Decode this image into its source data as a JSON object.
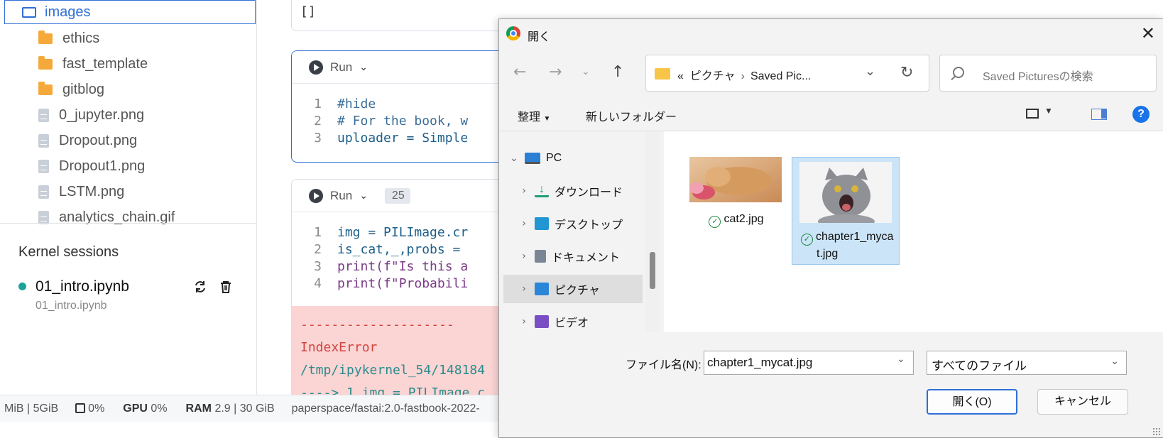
{
  "sidebar": {
    "selected_folder": "images",
    "items": [
      {
        "name": "ethics",
        "kind": "folder"
      },
      {
        "name": "fast_template",
        "kind": "folder"
      },
      {
        "name": "gitblog",
        "kind": "folder"
      },
      {
        "name": "0_jupyter.png",
        "kind": "file"
      },
      {
        "name": "Dropout.png",
        "kind": "file"
      },
      {
        "name": "Dropout1.png",
        "kind": "file"
      },
      {
        "name": "LSTM.png",
        "kind": "file"
      },
      {
        "name": "analytics_chain.gif",
        "kind": "file"
      }
    ],
    "kernel_heading": "Kernel sessions",
    "kernel": {
      "name": "01_intro.ipynb",
      "path": "01_intro.ipynb"
    }
  },
  "notebook": {
    "output_empty": "[]",
    "cell1": {
      "run_label": "Run",
      "lines": [
        {
          "n": "1",
          "code": "#hide"
        },
        {
          "n": "2",
          "code": "# For the book, w"
        },
        {
          "n": "3",
          "code": "uploader = Simple"
        }
      ]
    },
    "cell2": {
      "run_label": "Run",
      "exec_count": "25",
      "lines": [
        {
          "n": "1",
          "code": "img = PILImage.cr"
        },
        {
          "n": "2",
          "code": "is_cat,_,probs = "
        },
        {
          "n": "3",
          "code": "print(f\"Is this a"
        },
        {
          "n": "4",
          "code": "print(f\"Probabili"
        }
      ],
      "error": {
        "dashes": "--------------------",
        "name": "IndexError",
        "trace": "/tmp/ipykernel_54/148184",
        "arrow": "----> 1 img = PILImage.c"
      }
    }
  },
  "statusbar": {
    "mem": "MiB | 5GiB",
    "cpu": "0%",
    "gpu_label": "GPU",
    "gpu": "0%",
    "ram_label": "RAM",
    "ram": "2.9 | 30 GiB",
    "image": "paperspace/fastai:2.0-fastbook-2022-"
  },
  "dialog": {
    "title": "開く",
    "address": {
      "prefix": "«",
      "crumb1": "ピクチャ",
      "crumb2": "Saved Pic..."
    },
    "search_placeholder": "Saved Picturesの検索",
    "organize": "整理",
    "new_folder": "新しいフォルダー",
    "nav": [
      {
        "label": "PC",
        "color": "#2b7fd4"
      },
      {
        "label": "ダウンロード",
        "color": "#1e9e7a"
      },
      {
        "label": "デスクトップ",
        "color": "#2196d3"
      },
      {
        "label": "ドキュメント",
        "color": "#7a8696"
      },
      {
        "label": "ピクチャ",
        "color": "#2b86d9"
      },
      {
        "label": "ビデオ",
        "color": "#7b4fc4"
      }
    ],
    "files": [
      {
        "name": "cat2.jpg",
        "selected": false
      },
      {
        "name": "chapter1_mycat.jpg",
        "label_line1": "chapter1_myca",
        "label_line2": "t.jpg",
        "selected": true
      }
    ],
    "filename_label": "ファイル名(N):",
    "filename_value": "chapter1_mycat.jpg",
    "filetype": "すべてのファイル",
    "open_button": "開く(O)",
    "cancel_button": "キャンセル"
  }
}
